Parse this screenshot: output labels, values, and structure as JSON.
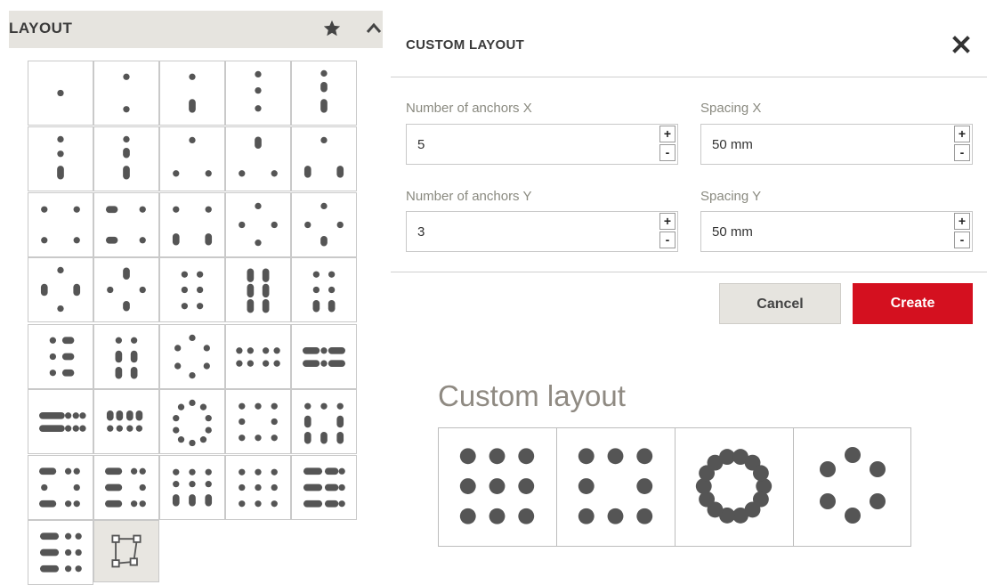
{
  "panel": {
    "title": "LAYOUT",
    "icons": [
      "star-icon",
      "chevron-up-icon"
    ]
  },
  "layouts": [
    "single",
    "two-vertical",
    "dot-over-pill",
    "three-vertical",
    "pill-column",
    "dot-dot-pill",
    "dot-pill-pill",
    "triangle-dots",
    "triangle-pill-top",
    "triangle-pill-bottom",
    "four-dots",
    "pill-dot-pairs",
    "four-pill-bottom",
    "diamond-dots",
    "diamond-pill",
    "diamond-pills-side",
    "diamond-pill-vertical",
    "six-dots",
    "pills-2x3",
    "dots-pills-mixed",
    "three-rows-pills",
    "pill-grid-2x3",
    "hexagon-dots",
    "eight-dots",
    "ten-dots-pills",
    "ten-pills",
    "pills-dots-rows",
    "ring-dots",
    "frame-3x3",
    "frame-pills",
    "pill-row-dots",
    "pills-mixed-frame",
    "grid-mixed",
    "grid-3x3-dots",
    "pills-row-grid",
    "grid-pills-dots",
    "custom"
  ],
  "dialog": {
    "title": "CUSTOM LAYOUT",
    "close_icon": "close-icon",
    "anchors_x_label": "Number of anchors X",
    "anchors_x_value": "5",
    "spacing_x_label": "Spacing X",
    "spacing_x_value": "50 mm",
    "anchors_y_label": "Number of anchors Y",
    "anchors_y_value": "3",
    "spacing_y_label": "Spacing Y",
    "spacing_y_value": "50 mm",
    "plus": "+",
    "minus": "-",
    "cancel_label": "Cancel",
    "create_label": "Create"
  },
  "preview": {
    "title": "Custom layout",
    "items": [
      "grid-3x3",
      "frame-3x3",
      "ring",
      "hexagon"
    ]
  },
  "colors": {
    "accent": "#d4101f",
    "dot": "#555555",
    "header_bg": "#e6e4df"
  }
}
